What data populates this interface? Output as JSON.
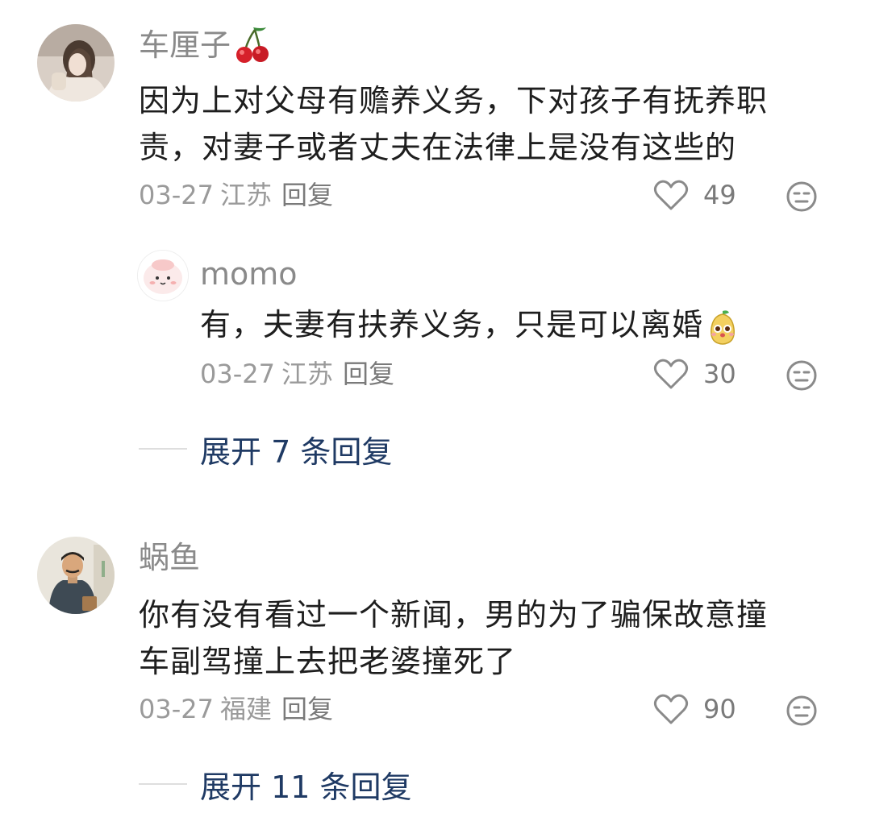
{
  "comments": [
    {
      "username": "车厘子",
      "username_emoji": "cherry-icon",
      "text_lines": [
        "因为上对父母有赡养义务，下对孩子有抚养职",
        "责，对妻子或者丈夫在法律上是没有这些的"
      ],
      "date": "03-27",
      "region": "江苏",
      "reply_label": "回复",
      "likes": "49"
    },
    {
      "username": "蜗鱼",
      "text_lines": [
        "你有没有看过一个新闻，男的为了骗保故意撞",
        "车副驾撞上去把老婆撞死了"
      ],
      "date": "03-27",
      "region": "福建",
      "reply_label": "回复",
      "likes": "90"
    }
  ],
  "replies": [
    {
      "username": "momo",
      "text": "有，夫妻有扶养义务，只是可以离婚",
      "text_emoji": "pear-face-icon",
      "date": "03-27",
      "region": "江苏",
      "reply_label": "回复",
      "likes": "30"
    }
  ],
  "expand": [
    {
      "label": "展开 7 条回复"
    },
    {
      "label": "展开 11 条回复"
    }
  ],
  "colors": {
    "username": "#8a8a8a",
    "text": "#1e1e1e",
    "meta": "#9a9a9a",
    "expand": "#1f3a64",
    "divider": "#dedede"
  }
}
